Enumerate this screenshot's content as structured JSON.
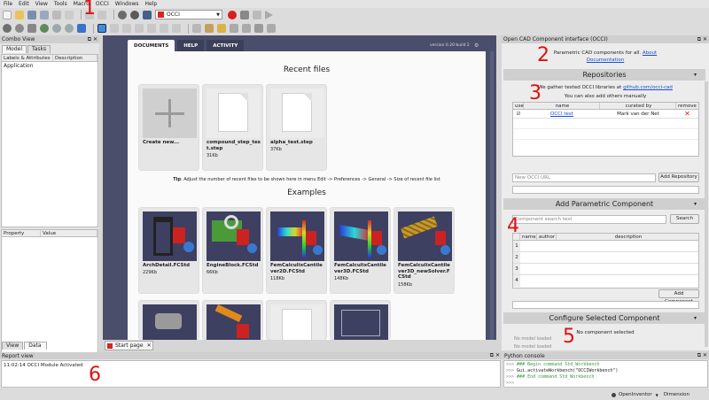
{
  "menu": [
    "File",
    "Edit",
    "View",
    "Tools",
    "Macro",
    "OCCI",
    "Windows",
    "Help"
  ],
  "toolbar": {
    "workbench": "OCCI"
  },
  "combo": {
    "title": "Combo View",
    "tabs": [
      "Model",
      "Tasks"
    ],
    "cols": [
      "Labels & Attributes",
      "Description"
    ],
    "item": "Application",
    "prop_cols": [
      "Property",
      "Value"
    ],
    "bottom_tabs": [
      "View",
      "Data"
    ]
  },
  "start": {
    "tabs": [
      "DOCUMENTS",
      "HELP",
      "ACTIVITY"
    ],
    "version": "version 0.20 build 2",
    "recent_title": "Recent files",
    "recent": [
      {
        "name": "Create new...",
        "size": ""
      },
      {
        "name": "compound_step_test.step",
        "size": "31Kb"
      },
      {
        "name": "alpha_test.step",
        "size": "37Kb"
      }
    ],
    "tip_bold": "Tip",
    "tip": ": Adjust the number of recent files to be shown here in menu Edit -> Preferences -> General -> Size of recent file list",
    "examples_title": "Examples",
    "examples": [
      {
        "name": "ArchDetail.FCStd",
        "size": "229Kb"
      },
      {
        "name": "EngineBlock.FCStd",
        "size": "66Kb"
      },
      {
        "name": "FemCalculixCantilever2D.FCStd",
        "size": "118Kb"
      },
      {
        "name": "FemCalculixCantilever3D.FCStd",
        "size": "148Kb"
      },
      {
        "name": "FemCalculixCantilever3D_newSolver.FCStd",
        "size": "158Kb"
      }
    ],
    "doc_tab": "Start page"
  },
  "occi": {
    "title": "Open CAD Component interface (OCCI)",
    "intro": "Parametric CAD components for all.",
    "about": "About",
    "documentation": "Documentation",
    "repos_title": "Repositories",
    "gather": "We gather tested OCCI libraries at",
    "gather_link": "github.com/occi-cad",
    "also": "You can also add others manually",
    "repo_cols": [
      "use",
      "name",
      "curated by",
      "remove"
    ],
    "repo_rows": [
      {
        "name": "OCCI test",
        "curator": "Mark van der Net"
      }
    ],
    "url_placeholder": "New OCCI URL",
    "add_repo": "Add Repository",
    "add_comp_title": "Add Parametric Component",
    "search_placeholder": "Component search text",
    "search": "Search",
    "comp_cols": [
      "name",
      "author",
      "description"
    ],
    "comp_rows": [
      "1",
      "2",
      "3",
      "4"
    ],
    "add_component": "Add Component",
    "configure_title": "Configure Selected Component",
    "no_selected": "No component selected",
    "no_model1": "No model loaded",
    "no_model2": "No model loaded"
  },
  "report": {
    "title": "Report view",
    "line": "11:02:14  OCCI Module Activated"
  },
  "python": {
    "title": "Python console",
    "lines": [
      {
        "p": ">>> ",
        "t": "### Begin command Std_Workbench",
        "c": "#3a9a3a"
      },
      {
        "p": ">>> ",
        "t": "Gui.activateWorkbench(\"OCCIWorkbench\")",
        "c": "#222"
      },
      {
        "p": ">>> ",
        "t": "### End command Std_Workbench",
        "c": "#3a9a3a"
      },
      {
        "p": ">>> ",
        "t": "",
        "c": "#222"
      }
    ]
  },
  "status": {
    "nav": "OpenInventor",
    "dim": "Dimension"
  },
  "annotations": [
    "1",
    "2",
    "3",
    "4",
    "5",
    "6"
  ]
}
